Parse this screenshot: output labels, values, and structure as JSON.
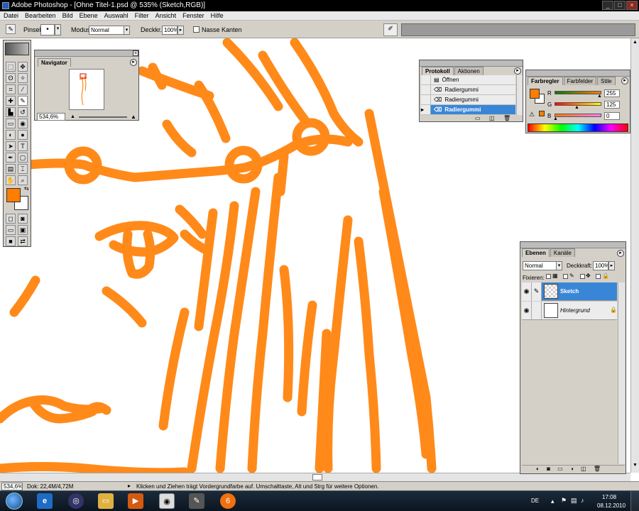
{
  "window": {
    "title": "Adobe Photoshop - [Ohne Titel-1.psd @ 535% (Sketch,RGB)]",
    "controls": [
      "_",
      "□",
      "×"
    ]
  },
  "menu": [
    "Datei",
    "Bearbeiten",
    "Bild",
    "Ebene",
    "Auswahl",
    "Filter",
    "Ansicht",
    "Fenster",
    "Hilfe"
  ],
  "options": {
    "brush_label": "Pinsel:",
    "brush_size": "•",
    "mode_label": "Modus:",
    "mode_value": "Normal",
    "opacity_label": "Deckkr.:",
    "opacity_value": "100%",
    "wet_edges_label": "Nasse Kanten"
  },
  "navigator": {
    "tab": "Navigator",
    "zoom": "534,6%"
  },
  "history": {
    "tabs": [
      "Protokoll",
      "Aktionen"
    ],
    "items": [
      {
        "label": "Öffnen",
        "selected": false
      },
      {
        "label": "Radiergummi",
        "selected": false
      },
      {
        "label": "Radiergummi",
        "selected": false
      },
      {
        "label": "Radiergummi",
        "selected": true
      }
    ]
  },
  "color": {
    "tabs": [
      "Farbregler",
      "Farbfelder",
      "Stile"
    ],
    "channels": [
      {
        "name": "R",
        "value": "255",
        "level": 1.0
      },
      {
        "name": "G",
        "value": "125",
        "level": 0.49
      },
      {
        "name": "B",
        "value": "0",
        "level": 0.0
      }
    ],
    "foreground": "#ff7d00",
    "background": "#ffffff"
  },
  "layers": {
    "tabs": [
      "Ebenen",
      "Kanäle"
    ],
    "blend_mode": "Normal",
    "opacity_label": "Deckkraft:",
    "opacity_value": "100%",
    "lock_label": "Fixieren:",
    "items": [
      {
        "name": "Sketch",
        "selected": true
      },
      {
        "name": "Hintergrund",
        "selected": false
      }
    ]
  },
  "status": {
    "zoom": "534,6%",
    "doc": "Dok: 22,4M/4,72M",
    "hint": "Klicken und Ziehen trägt Vordergrundfarbe auf. Umschalttaste, Alt und Strg für weitere Optionen."
  },
  "taskbar": {
    "lang": "DE",
    "time": "17:08",
    "date": "08.12.2010",
    "apps": [
      "start-orb",
      "internet-explorer-icon",
      "media-player-icon",
      "folder-icon",
      "media-player-play-icon",
      "photoshop-eye-icon",
      "inkscape-icon",
      "alarm-icon"
    ]
  },
  "colors": {
    "stroke": "#ff8a1a",
    "selection": "#3a86d6"
  }
}
